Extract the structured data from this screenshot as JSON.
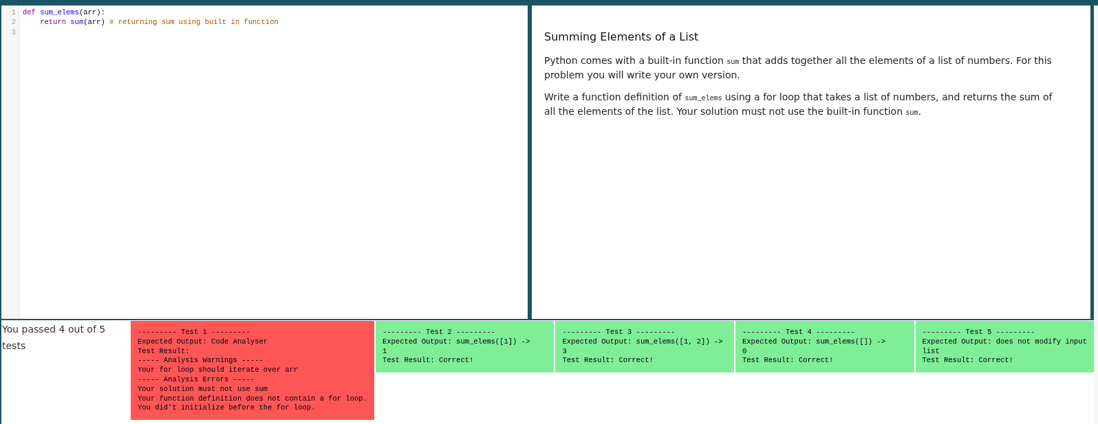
{
  "editor": {
    "lines": [
      {
        "number": "1",
        "tokens": [
          {
            "text": "def ",
            "kind": "keyword"
          },
          {
            "text": "sum_elems",
            "kind": "def"
          },
          {
            "text": "(arr):",
            "kind": "plain"
          }
        ]
      },
      {
        "number": "2",
        "tokens": [
          {
            "text": "    return ",
            "kind": "keyword"
          },
          {
            "text": "sum",
            "kind": "builtin"
          },
          {
            "text": "(arr) ",
            "kind": "plain"
          },
          {
            "text": "# returning sum using built in function",
            "kind": "comment"
          }
        ]
      },
      {
        "number": "3"
      }
    ]
  },
  "problem": {
    "title": "Summing Elements of a List",
    "paragraphs": [
      [
        {
          "text": "Python comes with a built-in function ",
          "kind": "text"
        },
        {
          "text": "sum",
          "kind": "code"
        },
        {
          "text": " that adds together all the elements of a list of numbers. For this problem you will write your own version.",
          "kind": "text"
        }
      ],
      [
        {
          "text": "Write a function definition of ",
          "kind": "text"
        },
        {
          "text": "sum_elems",
          "kind": "code"
        },
        {
          "text": " using a for loop that takes a list of numbers, and returns the sum of all the elements of the list. Your solution must not use the built-in function ",
          "kind": "text"
        },
        {
          "text": "sum",
          "kind": "code"
        },
        {
          "text": ".",
          "kind": "text"
        }
      ]
    ]
  },
  "results": {
    "summary": "You passed 4 out of 5 tests",
    "tests": [
      {
        "passed": false,
        "lines": [
          "--------- Test 1 ---------",
          "Expected Output: Code Analyser",
          "Test Result:",
          "----- Analysis Warnings -----",
          "Your for loop should iterate over arr",
          "----- Analysis Errors -----",
          "Your solution must not use sum",
          "Your function definition does not contain a for loop.",
          "You did't initialize before the for loop."
        ]
      },
      {
        "passed": true,
        "lines": [
          "--------- Test 2 ---------",
          "Expected Output: sum_elems([1]) ->",
          "1",
          "Test Result: Correct!"
        ]
      },
      {
        "passed": true,
        "lines": [
          "--------- Test 3 ---------",
          "Expected Output: sum_elems([1, 2]) ->",
          "3",
          "Test Result: Correct!"
        ]
      },
      {
        "passed": true,
        "lines": [
          "--------- Test 4 ---------",
          "Expected Output: sum_elems([]) ->",
          "0",
          "Test Result: Correct!"
        ]
      },
      {
        "passed": true,
        "lines": [
          "--------- Test 5 ---------",
          "Expected Output: does not modify input",
          "list",
          "Test Result: Correct!"
        ]
      }
    ]
  }
}
